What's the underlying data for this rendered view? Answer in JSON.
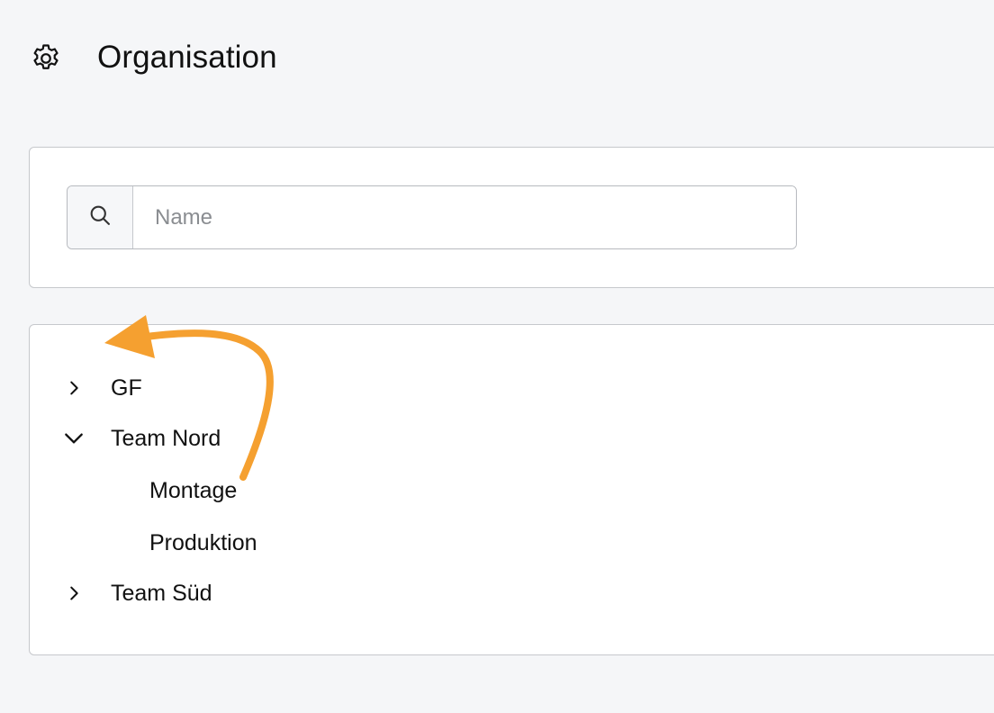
{
  "header": {
    "title": "Organisation",
    "icon": "gear-icon"
  },
  "search": {
    "placeholder": "Name",
    "value": "",
    "icon": "search-icon"
  },
  "tree": {
    "items": [
      {
        "label": "GF",
        "expanded": false,
        "level": 0
      },
      {
        "label": "Team Nord",
        "expanded": true,
        "level": 0,
        "children": [
          {
            "label": "Montage",
            "level": 1
          },
          {
            "label": "Produktion",
            "level": 1
          }
        ]
      },
      {
        "label": "Team Süd",
        "expanded": false,
        "level": 0
      }
    ]
  },
  "annotation": {
    "arrow_color": "#f5a030"
  }
}
